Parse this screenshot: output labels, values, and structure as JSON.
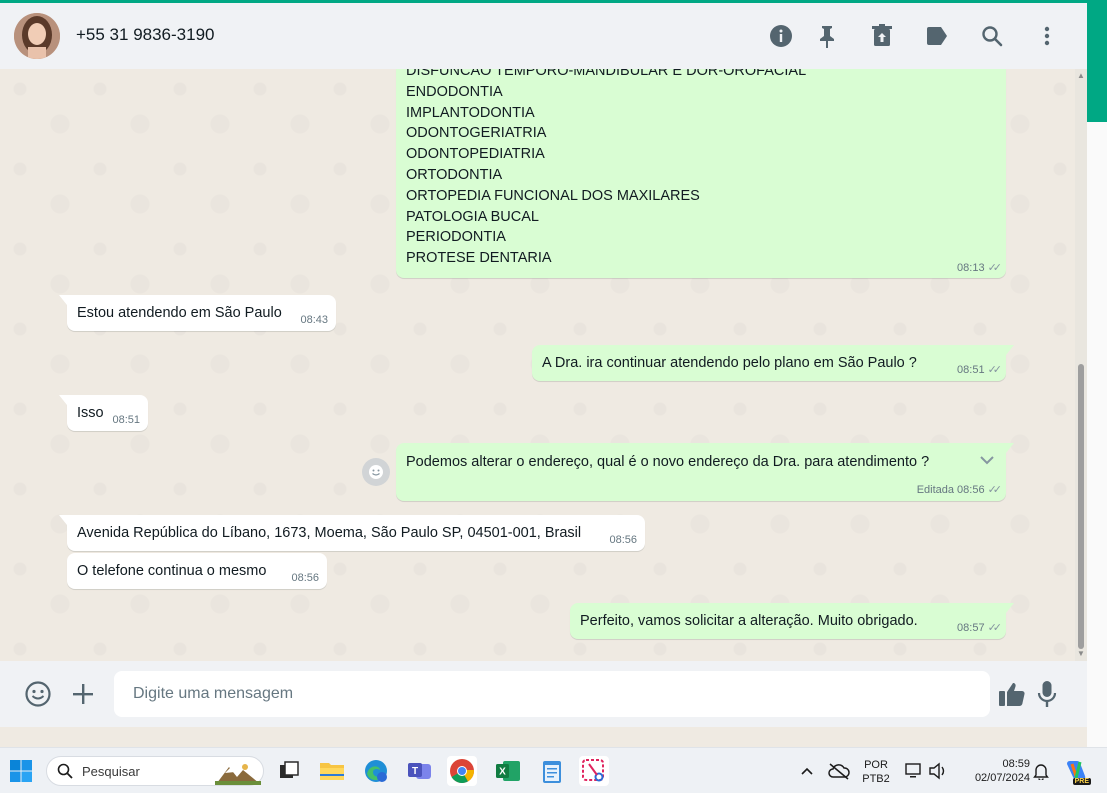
{
  "header": {
    "contact": "+55 31 9836-3190",
    "icons": [
      "info-icon",
      "pin-icon",
      "archive-icon",
      "label-icon",
      "search-icon",
      "menu-icon"
    ]
  },
  "messages": {
    "list_msg": {
      "lines": [
        "DISFUNCAO TEMPORO-MANDIBULAR E DOR-OROFACIAL",
        "ENDODONTIA",
        "IMPLANTODONTIA",
        "ODONTOGERIATRIA",
        "ODONTOPEDIATRIA",
        "ORTODONTIA",
        "ORTOPEDIA FUNCIONAL DOS MAXILARES",
        "PATOLOGIA BUCAL",
        "PERIODONTIA",
        "PROTESE DENTARIA"
      ],
      "time": "08:13"
    },
    "m1": {
      "text": "Estou atendendo em São Paulo",
      "time": "08:43"
    },
    "m2": {
      "text": "A Dra. ira continuar atendendo pelo plano em São Paulo ?",
      "time": "08:51"
    },
    "m3": {
      "text": "Isso",
      "time": "08:51"
    },
    "m4": {
      "text": "Podemos alterar o endereço, qual é o novo endereço da Dra. para atendimento ?",
      "edited": "Editada",
      "time": "08:56"
    },
    "m5": {
      "text": "Avenida República do Líbano, 1673, Moema, São Paulo SP, 04501-001, Brasil",
      "time": "08:56"
    },
    "m6": {
      "text": "O telefone continua o mesmo",
      "time": "08:56"
    },
    "m7": {
      "text": "Perfeito, vamos solicitar a alteração. Muito obrigado.",
      "time": "08:57"
    }
  },
  "footer": {
    "placeholder": "Digite uma mensagem"
  },
  "taskbar": {
    "search_label": "Pesquisar",
    "lang_line1": "POR",
    "lang_line2": "PTB2",
    "time": "08:59",
    "date": "02/07/2024",
    "copilot_badge": "PRE"
  },
  "colors": {
    "accent": "#00a884",
    "incoming": "#ffffff",
    "outgoing": "#d9fdd3",
    "background": "#efeae2"
  }
}
